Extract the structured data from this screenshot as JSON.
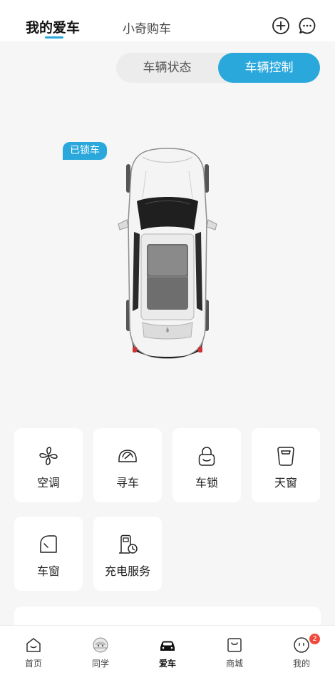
{
  "header": {
    "tab_mine": "我的爱车",
    "tab_shop": "小奇购车",
    "add_icon": "plus-circle-icon",
    "message_icon": "chat-bubble-icon",
    "accent_color": "#2aa8dc"
  },
  "segment": {
    "status_label": "车辆状态",
    "control_label": "车辆控制",
    "selected": "车辆控制"
  },
  "car": {
    "lock_status": "已锁车"
  },
  "controls": [
    {
      "label": "空调",
      "icon": "fan-icon"
    },
    {
      "label": "寻车",
      "icon": "car-front-icon"
    },
    {
      "label": "车锁",
      "icon": "lock-icon"
    },
    {
      "label": "天窗",
      "icon": "sunroof-icon"
    },
    {
      "label": "车窗",
      "icon": "window-icon"
    },
    {
      "label": "充电服务",
      "icon": "charging-station-icon"
    }
  ],
  "bottom_nav": {
    "items": [
      {
        "label": "首页",
        "icon": "home-icon"
      },
      {
        "label": "同学",
        "icon": "community-icon"
      },
      {
        "label": "爱车",
        "icon": "car-icon",
        "active": true
      },
      {
        "label": "商城",
        "icon": "shop-bag-icon"
      },
      {
        "label": "我的",
        "icon": "profile-face-icon",
        "badge": "2"
      }
    ]
  }
}
